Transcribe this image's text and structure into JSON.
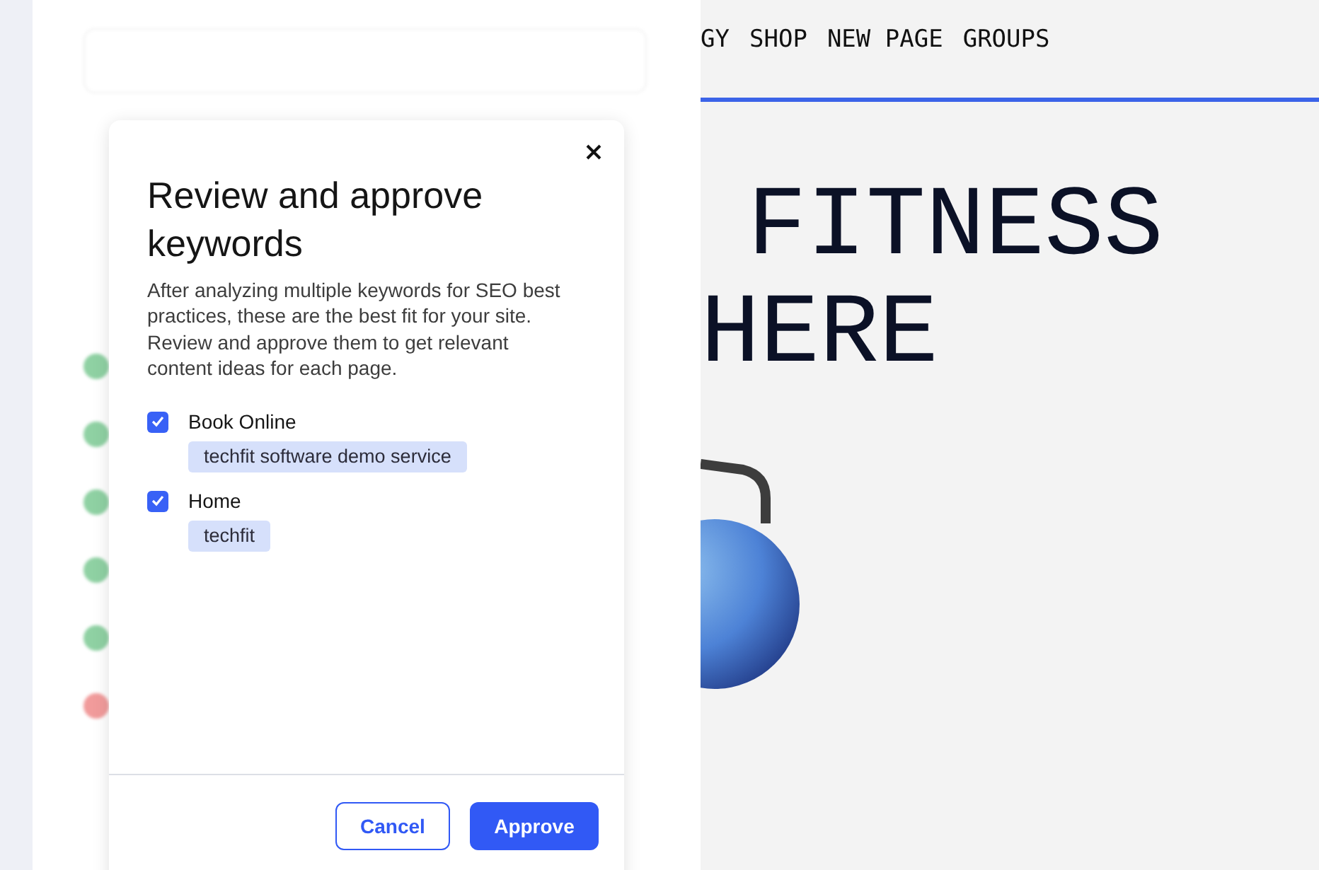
{
  "site_nav": [
    "GY",
    "SHOP",
    "NEW PAGE",
    "GROUPS"
  ],
  "hero_lines": [
    "FITNESS",
    "HERE"
  ],
  "background_rows": [
    {
      "color": "#8fd1a3"
    },
    {
      "color": "#8fd1a3"
    },
    {
      "color": "#8fd1a3"
    },
    {
      "color": "#8fd1a3"
    },
    {
      "color": "#8fd1a3"
    },
    {
      "color": "#f19b9b"
    }
  ],
  "dialog": {
    "title": "Review and approve keywords",
    "description": "After analyzing multiple keywords for SEO best practices, these are the best fit for your site. Review and approve them to get relevant content ideas for each page.",
    "pages": [
      {
        "name": "Book Online",
        "checked": true,
        "keywords": [
          "techfit software demo service"
        ]
      },
      {
        "name": "Home",
        "checked": true,
        "keywords": [
          "techfit"
        ]
      }
    ],
    "buttons": [
      {
        "label": "Cancel",
        "kind": "secondary"
      },
      {
        "label": "Approve",
        "kind": "primary"
      }
    ]
  }
}
